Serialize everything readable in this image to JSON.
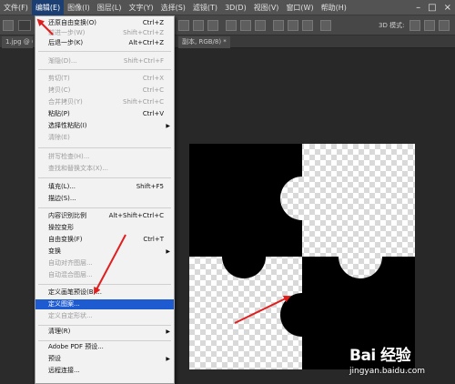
{
  "menubar": {
    "items": [
      "文件(F)",
      "编辑(E)",
      "图像(I)",
      "图层(L)",
      "文字(Y)",
      "选择(S)",
      "滤镜(T)",
      "3D(D)",
      "视图(V)",
      "窗口(W)",
      "帮助(H)"
    ],
    "active_index": 1
  },
  "optionsbar": {
    "mode_label": "3D 模式:"
  },
  "tabs": {
    "left_tab": "1.jpg @ 66",
    "right_tab": "副本, RGB/8) *"
  },
  "edit_menu": {
    "items": [
      {
        "label": "还原自由变换(O)",
        "shortcut": "Ctrl+Z",
        "disabled": false
      },
      {
        "label": "前进一步(W)",
        "shortcut": "Shift+Ctrl+Z",
        "disabled": true
      },
      {
        "label": "后退一步(K)",
        "shortcut": "Alt+Ctrl+Z",
        "disabled": false
      },
      {
        "label": "渐隐(D)...",
        "shortcut": "Shift+Ctrl+F",
        "disabled": true
      },
      {
        "label": "剪切(T)",
        "shortcut": "Ctrl+X",
        "disabled": true
      },
      {
        "label": "拷贝(C)",
        "shortcut": "Ctrl+C",
        "disabled": true
      },
      {
        "label": "合并拷贝(Y)",
        "shortcut": "Shift+Ctrl+C",
        "disabled": true
      },
      {
        "label": "粘贴(P)",
        "shortcut": "Ctrl+V",
        "disabled": false
      },
      {
        "label": "选择性粘贴(I)",
        "shortcut": "",
        "disabled": false,
        "submenu": true
      },
      {
        "label": "清除(E)",
        "shortcut": "",
        "disabled": true
      },
      {
        "label": "拼写检查(H)...",
        "shortcut": "",
        "disabled": true
      },
      {
        "label": "查找和替换文本(X)...",
        "shortcut": "",
        "disabled": true
      },
      {
        "label": "填充(L)...",
        "shortcut": "Shift+F5",
        "disabled": false
      },
      {
        "label": "描边(S)...",
        "shortcut": "",
        "disabled": false
      },
      {
        "label": "内容识别比例",
        "shortcut": "Alt+Shift+Ctrl+C",
        "disabled": false
      },
      {
        "label": "操控变形",
        "shortcut": "",
        "disabled": false
      },
      {
        "label": "自由变换(F)",
        "shortcut": "Ctrl+T",
        "disabled": false
      },
      {
        "label": "变换",
        "shortcut": "",
        "disabled": false,
        "submenu": true
      },
      {
        "label": "自动对齐图层...",
        "shortcut": "",
        "disabled": true
      },
      {
        "label": "自动混合图层...",
        "shortcut": "",
        "disabled": true
      },
      {
        "label": "定义画笔预设(B)...",
        "shortcut": "",
        "disabled": false
      },
      {
        "label": "定义图案...",
        "shortcut": "",
        "disabled": false,
        "highlighted": true
      },
      {
        "label": "定义自定形状...",
        "shortcut": "",
        "disabled": true
      },
      {
        "label": "清理(R)",
        "shortcut": "",
        "disabled": false,
        "submenu": true
      },
      {
        "label": "Adobe PDF 预设...",
        "shortcut": "",
        "disabled": false
      },
      {
        "label": "预设",
        "shortcut": "",
        "disabled": false,
        "submenu": true
      },
      {
        "label": "远程连接...",
        "shortcut": "",
        "disabled": false
      }
    ]
  },
  "watermark": {
    "brand": "Bai 经验",
    "url": "jingyan.baidu.com"
  },
  "colors": {
    "menubar_bg": "#535353",
    "highlight": "#1e5bd1",
    "annotation_arrow": "#e01e1e"
  }
}
